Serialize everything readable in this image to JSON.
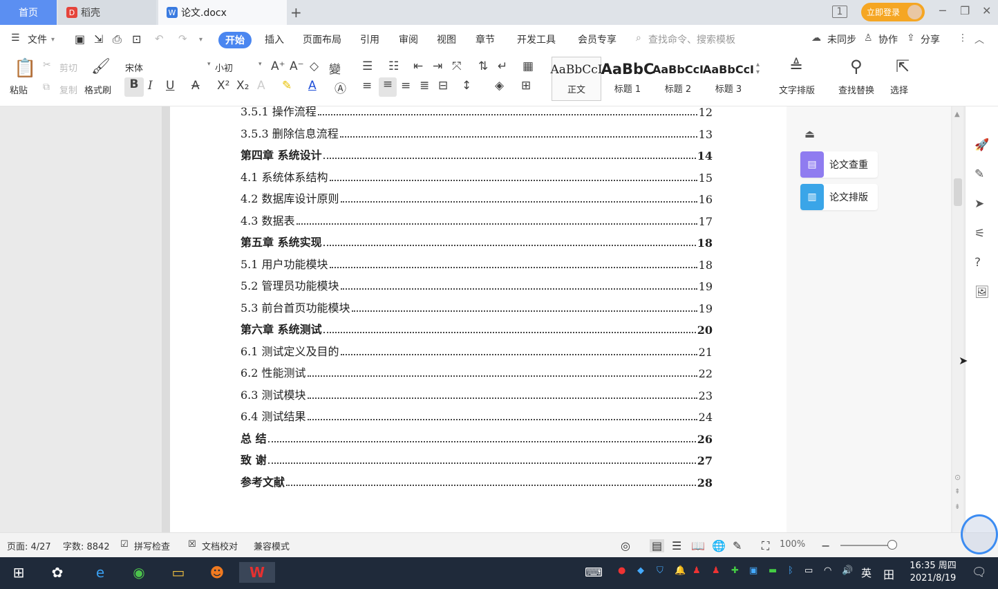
{
  "tabs": {
    "home": "首页",
    "daoke": "稻壳",
    "doc": "论文.docx",
    "new_tab": "+"
  },
  "title_right": {
    "login": "立即登录"
  },
  "menu": {
    "file": "文件",
    "items": [
      "开始",
      "插入",
      "页面布局",
      "引用",
      "审阅",
      "视图",
      "章节",
      "开发工具",
      "会员专享"
    ],
    "search": "查找命令、搜索模板",
    "unsync": "未同步",
    "collab": "协作",
    "share": "分享"
  },
  "ribbon": {
    "paste": "粘贴",
    "cut": "剪切",
    "copy": "复制",
    "format_painter": "格式刷",
    "font": "宋体",
    "size": "小初",
    "styles": [
      {
        "preview": "AaBbCcI",
        "name": "正文"
      },
      {
        "preview": "AaBbC",
        "name": "标题 1"
      },
      {
        "preview": "AaBbCcI",
        "name": "标题 2"
      },
      {
        "preview": "AaBbCcI",
        "name": "标题 3"
      }
    ],
    "text_layout": "文字排版",
    "find_replace": "查找替换",
    "select": "选择"
  },
  "toc": [
    {
      "title": "3.5.1 操作流程",
      "page": "12",
      "bold": false
    },
    {
      "title": "3.5.3 删除信息流程",
      "page": "13",
      "bold": false
    },
    {
      "title": "第四章  系统设计",
      "page": "14",
      "bold": true
    },
    {
      "title": "4.1  系统体系结构",
      "page": "15",
      "bold": false
    },
    {
      "title": "4.2  数据库设计原则",
      "page": "16",
      "bold": false
    },
    {
      "title": "4.3  数据表",
      "page": "17",
      "bold": false
    },
    {
      "title": "第五章  系统实现",
      "page": "18",
      "bold": true
    },
    {
      "title": "5.1 用户功能模块",
      "page": "18",
      "bold": false
    },
    {
      "title": "5.2 管理员功能模块",
      "page": "19",
      "bold": false
    },
    {
      "title": "5.3 前台首页功能模块",
      "page": "19",
      "bold": false
    },
    {
      "title": "第六章   系统测试",
      "page": "20",
      "bold": true
    },
    {
      "title": "6.1 测试定义及目的",
      "page": "21",
      "bold": false
    },
    {
      "title": "6.2 性能测试",
      "page": "22",
      "bold": false
    },
    {
      "title": "6.3 测试模块",
      "page": "23",
      "bold": false
    },
    {
      "title": "6.4 测试结果",
      "page": "24",
      "bold": false
    },
    {
      "title": "总   结",
      "page": "26",
      "bold": true
    },
    {
      "title": "致   谢",
      "page": "27",
      "bold": true
    },
    {
      "title": "参考文献",
      "page": "28",
      "bold": true
    }
  ],
  "side_panel": {
    "check": "论文查重",
    "layout": "论文排版"
  },
  "status": {
    "page": "页面: 4/27",
    "words": "字数: 8842",
    "spell": "拼写检查",
    "proof": "文档校对",
    "compat": "兼容模式",
    "zoom": "100%"
  },
  "taskbar": {
    "ime": "英",
    "time": "16:35 周四",
    "date": "2021/8/19"
  },
  "colors": {
    "accent": "#4a86f0",
    "home_tab": "#5b8ff2",
    "login": "#f5a623",
    "taskbar": "#1f2a3a"
  }
}
